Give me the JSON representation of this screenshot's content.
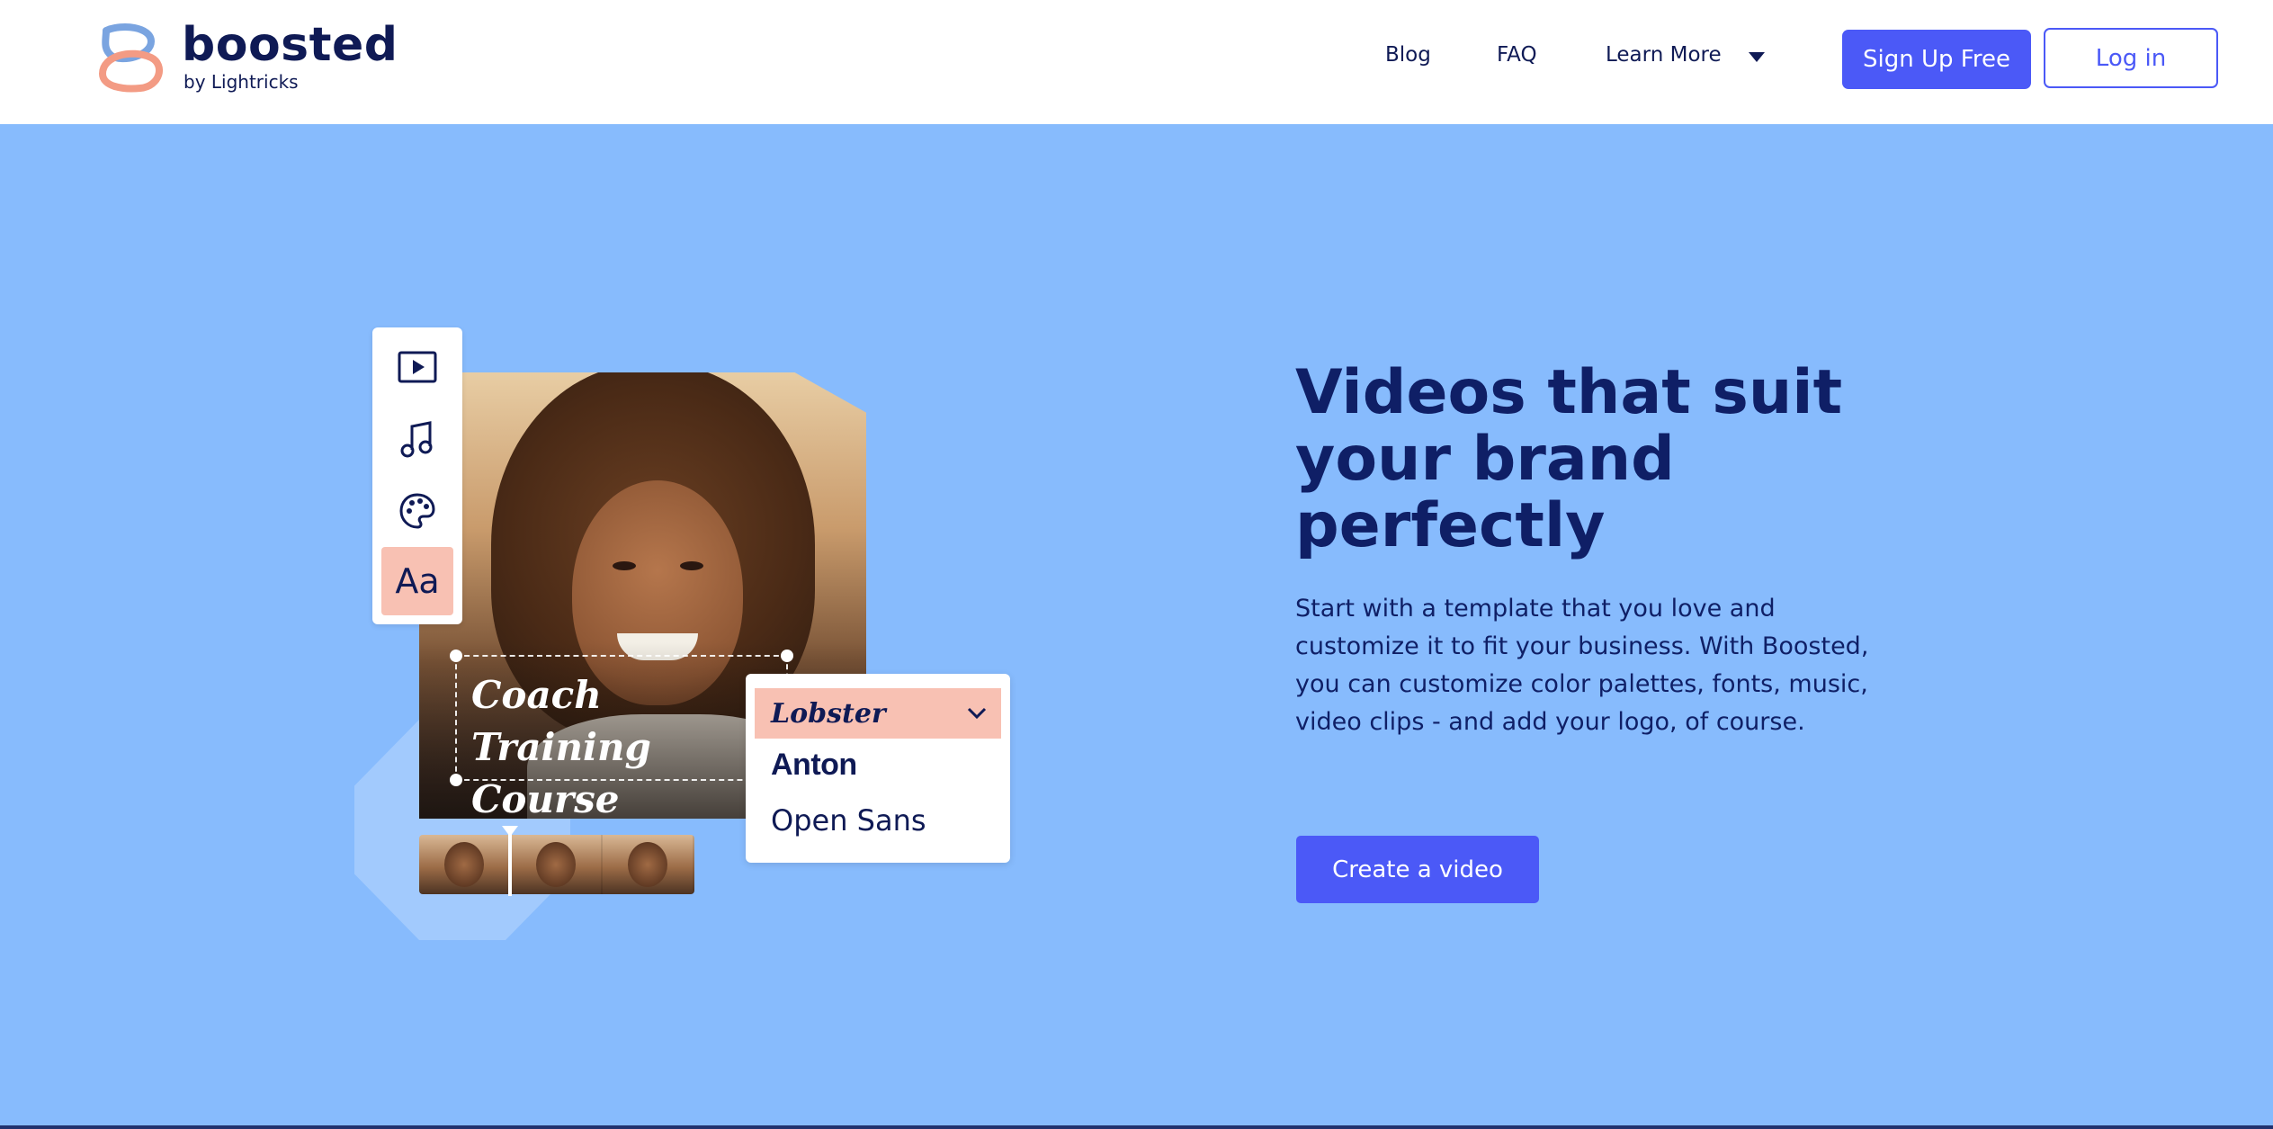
{
  "brand": {
    "name": "boosted",
    "tagline": "by Lightricks"
  },
  "nav": {
    "blog": "Blog",
    "faq": "FAQ",
    "learn_more": "Learn More",
    "signup": "Sign Up Free",
    "login": "Log in"
  },
  "editor": {
    "tools": [
      "play-video-icon",
      "music-note-icon",
      "palette-icon",
      "text-font-icon"
    ],
    "text_tool_label": "Aa",
    "caption_line1": "Coach Training",
    "caption_line2": "Course",
    "font_selected": "Lobster",
    "font_options": [
      "Anton",
      "Open Sans"
    ]
  },
  "hero": {
    "title": "Videos that suit your brand perfectly",
    "body": "Start with a template that you love and customize it to fit your business. With Boosted, you can customize color palettes, fonts, music, video clips - and add your logo, of course.",
    "cta": "Create a video"
  },
  "colors": {
    "accent": "#4b59f7",
    "hero_bg": "#87bbfd",
    "text_dark": "#0f1f66",
    "highlight": "#f8c1b3"
  }
}
